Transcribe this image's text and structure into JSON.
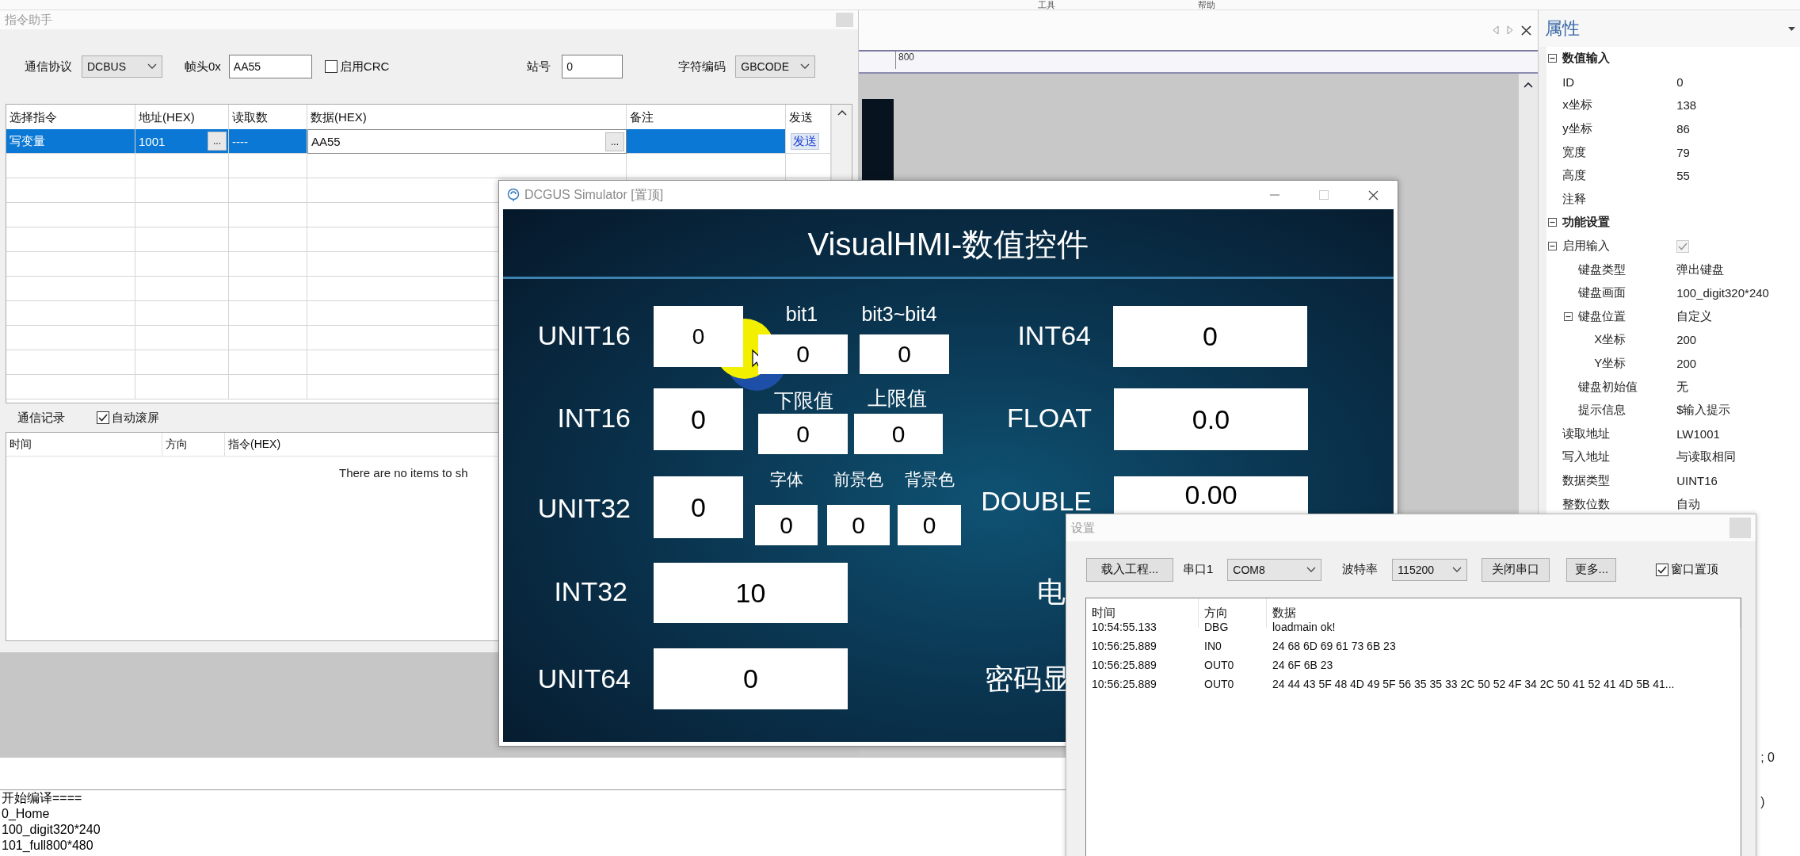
{
  "menu": [
    "工具",
    "帮助"
  ],
  "command_helper": {
    "title": "指令助手",
    "protocol_label": "通信协议",
    "protocol": "DCBUS",
    "header_label": "帧头0x",
    "header_value": "AA55",
    "crc": {
      "label": "启用CRC",
      "checked": false
    },
    "station_label": "站号",
    "station_value": "0",
    "encoding_label": "字符编码",
    "encoding": "GBCODE",
    "table": {
      "columns": [
        "选择指令",
        "地址(HEX)",
        "读取数",
        "数据(HEX)",
        "备注",
        "发送"
      ],
      "rows": [
        {
          "selected": true,
          "command": "写变量",
          "address": "1001",
          "address_button": "...",
          "count": "----",
          "data": "AA55",
          "data_button": "...",
          "send": "发送"
        }
      ]
    },
    "log": {
      "title": "通信记录",
      "auto_scroll": {
        "label": "自动滚屏",
        "checked": true
      },
      "columns": [
        "时间",
        "方向",
        "指令(HEX)"
      ],
      "empty_text": "There are no items to sh"
    }
  },
  "editor": {
    "ruler_label": "800"
  },
  "output": {
    "lines": [
      "开始编译====",
      "0_Home",
      "100_digit320*240",
      "101_full800*480"
    ]
  },
  "properties": {
    "title": "属性",
    "items": [
      {
        "kind": "category",
        "label": "数值输入",
        "expanded": true,
        "children": [
          {
            "kind": "property",
            "label": "ID",
            "value": "0"
          },
          {
            "kind": "property",
            "label": "x坐标",
            "value": "138"
          },
          {
            "kind": "property",
            "label": "y坐标",
            "value": "86"
          },
          {
            "kind": "property",
            "label": "宽度",
            "value": "79"
          },
          {
            "kind": "property",
            "label": "高度",
            "value": "55"
          },
          {
            "kind": "property",
            "label": "注释"
          }
        ]
      },
      {
        "kind": "category",
        "label": "功能设置",
        "expanded": true,
        "children": [
          {
            "kind": "checkbox",
            "label": "启用输入",
            "checked": true,
            "expanded": true,
            "children": [
              {
                "kind": "property",
                "label": "键盘类型",
                "value": "弹出键盘"
              },
              {
                "kind": "property",
                "label": "键盘画面",
                "value": "100_digit320*240"
              },
              {
                "kind": "property",
                "label": "键盘位置",
                "value": "自定义",
                "expanded": true,
                "children": [
                  {
                    "kind": "property",
                    "label": "X坐标",
                    "value": "200"
                  },
                  {
                    "kind": "property",
                    "label": "Y坐标",
                    "value": "200"
                  }
                ]
              },
              {
                "kind": "property",
                "label": "键盘初始值",
                "value": "无"
              },
              {
                "kind": "property",
                "label": "提示信息",
                "value": "$输入提示"
              }
            ]
          },
          {
            "kind": "property",
            "label": "读取地址",
            "value": "LW1001"
          },
          {
            "kind": "property",
            "label": "写入地址",
            "value": "与读取相同"
          },
          {
            "kind": "property",
            "label": "数据类型",
            "value": "UINT16"
          },
          {
            "kind": "property",
            "label": "整数位数",
            "value": "自动"
          }
        ]
      }
    ],
    "covered_values": [
      "; 0",
      ")"
    ]
  },
  "simulator": {
    "title": "DCGUS Simulator [置顶]",
    "screen_title": "VisualHMI-数值控件",
    "fields": [
      {
        "label": "UNIT16",
        "value": "0"
      },
      {
        "label": "INT16",
        "value": "0"
      },
      {
        "label": "UNIT32",
        "value": "0"
      },
      {
        "label": "INT32",
        "value": "10"
      },
      {
        "label": "UNIT64",
        "value": "0"
      },
      {
        "label": "INT64",
        "value": "0"
      },
      {
        "label": "FLOAT",
        "value": "0.0"
      },
      {
        "label": "DOUBLE",
        "value": "0.00"
      }
    ],
    "small_fields": [
      {
        "label": "bit1",
        "value": "0"
      },
      {
        "label": "bit3~bit4",
        "value": "0"
      },
      {
        "label": "下限值",
        "value": "0"
      },
      {
        "label": "上限值",
        "value": "0"
      },
      {
        "label": "字体",
        "value": "0"
      },
      {
        "label": "前景色",
        "value": "0"
      },
      {
        "label": "背景色",
        "value": "0"
      }
    ],
    "cut_labels": [
      "电",
      "密码显"
    ]
  },
  "settings": {
    "title": "设置",
    "load_button": "载入工程...",
    "port_label": "串口1",
    "port": "COM8",
    "baud_label": "波特率",
    "baud": "115200",
    "close_port_button": "关闭串口",
    "more_button": "更多...",
    "topmost": {
      "label": "窗口置顶",
      "checked": true
    },
    "log": {
      "columns": [
        "时间",
        "方向",
        "数据"
      ],
      "rows": [
        {
          "time": "10:54:55.133",
          "direction": "DBG",
          "data": "loadmain ok!"
        },
        {
          "time": "10:56:25.889",
          "direction": "IN0",
          "data": "24 68 6D 69 61 73 6B 23"
        },
        {
          "time": "10:56:25.889",
          "direction": "OUT0",
          "data": "24 6F 6B 23"
        },
        {
          "time": "10:56:25.889",
          "direction": "OUT0",
          "data": "24 44 43 5F 48 4D 49 5F 56 35 35 33 2C 50 52 4F 34 2C 50 41 52 41 4D 5B 41..."
        }
      ]
    }
  }
}
